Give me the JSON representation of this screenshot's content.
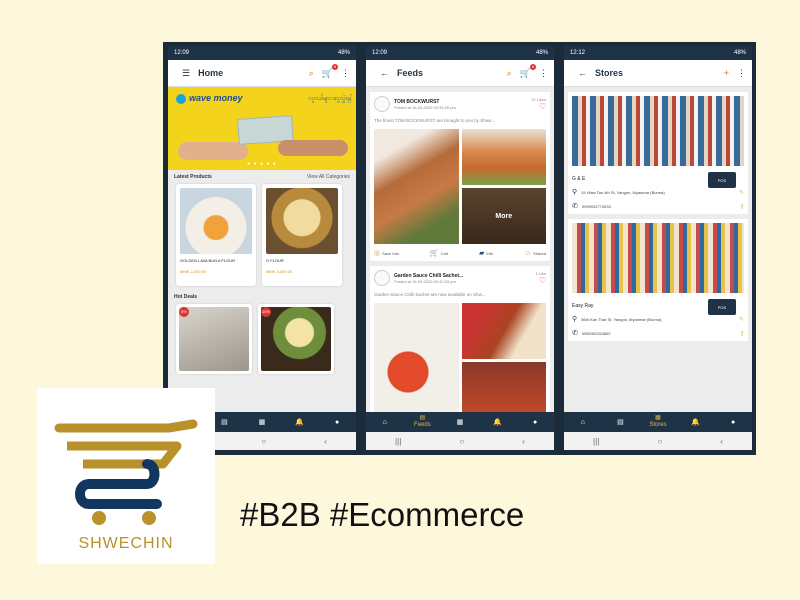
{
  "status_bar": {
    "home": {
      "time": "12:09",
      "battery": "48%"
    },
    "feeds": {
      "time": "12:09",
      "battery": "48%"
    },
    "stores": {
      "time": "12:12",
      "battery": "48%"
    }
  },
  "home": {
    "title": "Home",
    "cart_count": "5",
    "banner": {
      "brand": "wave money",
      "tagline": "လူငယ်များ ငွေလွှဲရန်"
    },
    "latest_label": "Latest Products",
    "view_all": "View All Categories",
    "products": [
      {
        "name": "GOLDEN LAVA BUN A FLOUR",
        "price": "MMK 2,200.00"
      },
      {
        "name": "G FLOUR",
        "price": "MMK 3,000.00"
      }
    ],
    "hot_deals_label": "Hot Deals",
    "deals": [
      {
        "off": "5%"
      },
      {
        "off": "10%"
      }
    ]
  },
  "feeds": {
    "title": "Feeds",
    "cart_count": "5",
    "posts": [
      {
        "author": "TOM BOCKWURST",
        "date": "Posted at 16-04-2020 03:34:05 pm",
        "likes": "12 Likes",
        "desc": "The finest TOM BOCKWURST are brought to you by Shwe...",
        "more": "More",
        "actions": [
          "Save Info",
          "Cart",
          "Info",
          "Shared"
        ]
      },
      {
        "author": "Garden Sauce Chilli Sachet...",
        "date": "Posted at 16-04-2020 03:42:03 pm",
        "likes": "1 Like",
        "desc": "Garden Sauce Chilli Sachet are now available on Shw..."
      }
    ]
  },
  "stores": {
    "title": "Stores",
    "items": [
      {
        "name": "G & E",
        "address": "15 Hlaw Tan 4th St, Yangon, Myanmar (Burma)",
        "phone": "0999932774533",
        "pos": "POS"
      },
      {
        "name": "Easy Ray",
        "address": "56th Kan Thar St, Yangon, Myanmar (Burma)",
        "phone": "0950302024887",
        "pos": "POS"
      }
    ]
  },
  "bottom_nav": {
    "active_feeds": "Feeds",
    "active_stores": "Stores"
  },
  "logo": {
    "text": "SHWECHIN"
  },
  "tagline": "#B2B #Ecommerce",
  "colors": {
    "navy": "#1f3347",
    "gold": "#c8a02a",
    "background": "#fdf8dc"
  }
}
